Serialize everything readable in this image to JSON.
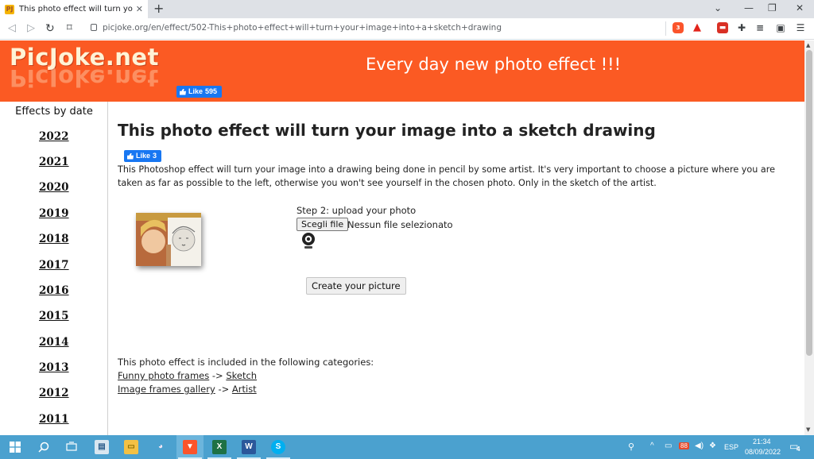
{
  "browser": {
    "tab_title": "This photo effect will turn your im",
    "tab_favicon": "PJ",
    "url": "picjoke.org/en/effect/502-This+photo+effect+will+turn+your+image+into+a+sketch+drawing",
    "extension_badge": "3"
  },
  "site": {
    "logo": "PicJoke.net",
    "tagline": "Every day new photo effect !!!",
    "header_like": {
      "label": "Like",
      "count": "595"
    },
    "header_color": "#fb5a23"
  },
  "sidebar": {
    "title": "Effects by date",
    "years": [
      "2022",
      "2021",
      "2020",
      "2019",
      "2018",
      "2017",
      "2016",
      "2015",
      "2014",
      "2013",
      "2012",
      "2011"
    ]
  },
  "main": {
    "title": "This photo effect will turn your image into a sketch drawing",
    "like": {
      "label": "Like",
      "count": "3"
    },
    "description": "This Photoshop effect will turn your image into a drawing being done in pencil by some artist. It's very important to choose a picture where you are taken as far as possible to the left, otherwise you won't see yourself in the chosen photo. Only in the sketch of the artist.",
    "step_label": "Step 2: upload your photo",
    "file_button": "Scegli file",
    "file_status": "Nessun file selezionato",
    "create_button": "Create your picture",
    "categories_intro": "This photo effect is included in the following categories:",
    "categories": [
      {
        "parent": "Funny photo frames",
        "sep": "->",
        "child": "Sketch"
      },
      {
        "parent": "Image frames gallery",
        "sep": "->",
        "child": "Artist"
      }
    ]
  },
  "taskbar": {
    "mail_badge": "88",
    "language": "ESP",
    "time": "21:34",
    "date": "08/09/2022",
    "notifications": "4"
  }
}
